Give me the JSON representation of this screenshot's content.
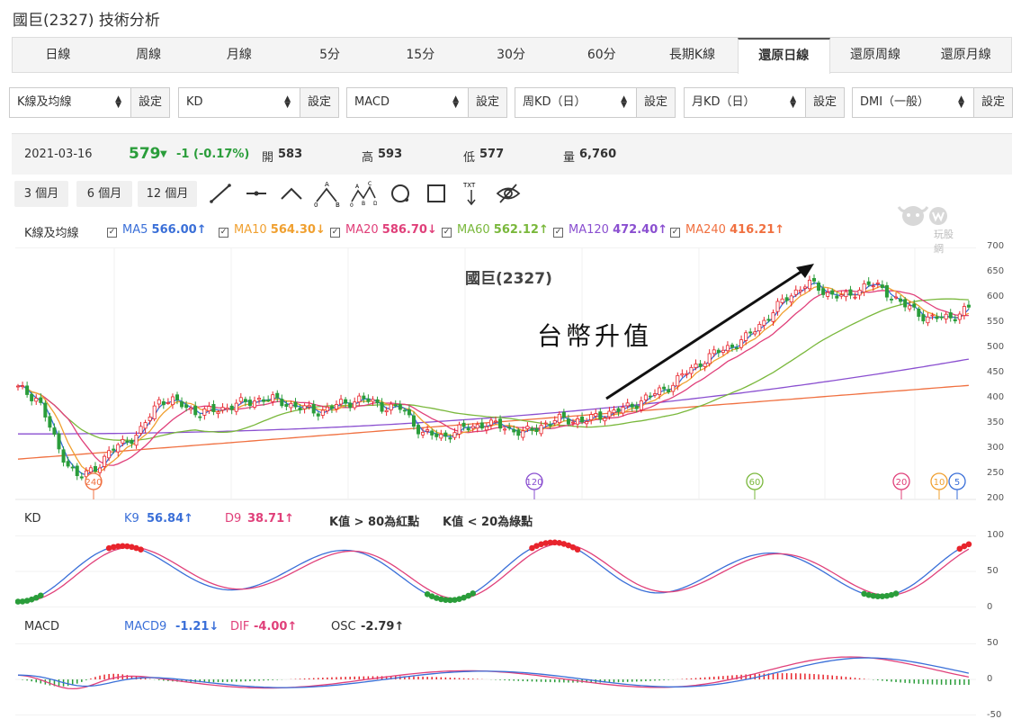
{
  "header": {
    "title": "國巨(2327) 技術分析"
  },
  "tabs": [
    "日線",
    "周線",
    "月線",
    "5分",
    "15分",
    "30分",
    "60分",
    "長期K線",
    "還原日線",
    "還原周線",
    "還原月線"
  ],
  "active_tab": "還原日線",
  "selectors": [
    {
      "value": "K線及均線",
      "button": "設定"
    },
    {
      "value": "KD",
      "button": "設定"
    },
    {
      "value": "MACD",
      "button": "設定"
    },
    {
      "value": "周KD（日）",
      "button": "設定"
    },
    {
      "value": "月KD（日）",
      "button": "設定"
    },
    {
      "value": "DMI（一般）",
      "button": "設定"
    }
  ],
  "quote": {
    "date": "2021-03-16",
    "price": "579",
    "change": "-1 (-0.17%)",
    "open_label": "開",
    "open": "583",
    "high_label": "高",
    "high": "593",
    "low_label": "低",
    "low": "577",
    "volume_label": "量",
    "volume": "6,760"
  },
  "ranges": [
    "3 個月",
    "6 個月",
    "12 個月"
  ],
  "tools": [
    "line-tool-icon",
    "horizontal-line-tool-icon",
    "angle-tool-icon",
    "abc-pattern-tool-icon",
    "abcd-pattern-tool-icon",
    "circle-tool-icon",
    "rectangle-tool-icon",
    "text-tool-icon",
    "hide-drawings-icon"
  ],
  "tool_text": {
    "a": "A",
    "o": "0",
    "b": "B",
    "c": "C",
    "d": "D",
    "txt": "TXT"
  },
  "logo_text": "玩股網",
  "main_panel": {
    "label": "K線及均線",
    "mas": [
      {
        "name": "MA5",
        "value": "566.00↑",
        "color": "#3a6fd8"
      },
      {
        "name": "MA10",
        "value": "564.30↓",
        "color": "#f0a030"
      },
      {
        "name": "MA20",
        "value": "586.70↓",
        "color": "#e0407a"
      },
      {
        "name": "MA60",
        "value": "562.12↑",
        "color": "#7ab83c"
      },
      {
        "name": "MA120",
        "value": "472.40↑",
        "color": "#8a4fd0"
      },
      {
        "name": "MA240",
        "value": "416.21↑",
        "color": "#f07040"
      }
    ],
    "chart_title": "國巨(2327)",
    "annotation": "台幣升值",
    "y_ticks": [
      "700",
      "650",
      "600",
      "550",
      "500",
      "450",
      "400",
      "350",
      "300",
      "250",
      "200"
    ],
    "markers": [
      "240",
      "120",
      "60",
      "20",
      "10",
      "5"
    ]
  },
  "kd_panel": {
    "label": "KD",
    "k_name": "K9",
    "k_value": "56.84↑",
    "d_name": "D9",
    "d_value": "38.71↑",
    "note1": "K值 > 80為紅點",
    "note2": "K值 < 20為綠點",
    "y_ticks": [
      "100",
      "50",
      "0"
    ]
  },
  "macd_panel": {
    "label": "MACD",
    "macd_name": "MACD9",
    "macd_value": "-1.21↓",
    "dif_name": "DIF",
    "dif_value": "-4.00↑",
    "osc_name": "OSC",
    "osc_value": "-2.79↑",
    "y_ticks": [
      "50",
      "0",
      "-50"
    ]
  },
  "chart_data": {
    "type": "line",
    "title": "國巨(2327)",
    "ylim": [
      200,
      700
    ],
    "close_approx": [
      420,
      400,
      300,
      240,
      270,
      310,
      330,
      400,
      390,
      370,
      380,
      390,
      400,
      395,
      380,
      375,
      390,
      400,
      385,
      380,
      330,
      325,
      340,
      350,
      345,
      330,
      350,
      360,
      355,
      370,
      380,
      400,
      420,
      450,
      480,
      500,
      520,
      560,
      600,
      630,
      610,
      600,
      630,
      610,
      580,
      560,
      560,
      579
    ],
    "series": [
      {
        "name": "MA5",
        "last": 566.0
      },
      {
        "name": "MA10",
        "last": 564.3
      },
      {
        "name": "MA20",
        "last": 586.7
      },
      {
        "name": "MA60",
        "last": 562.12
      },
      {
        "name": "MA120",
        "last": 472.4
      },
      {
        "name": "MA240",
        "last": 416.21
      }
    ]
  }
}
